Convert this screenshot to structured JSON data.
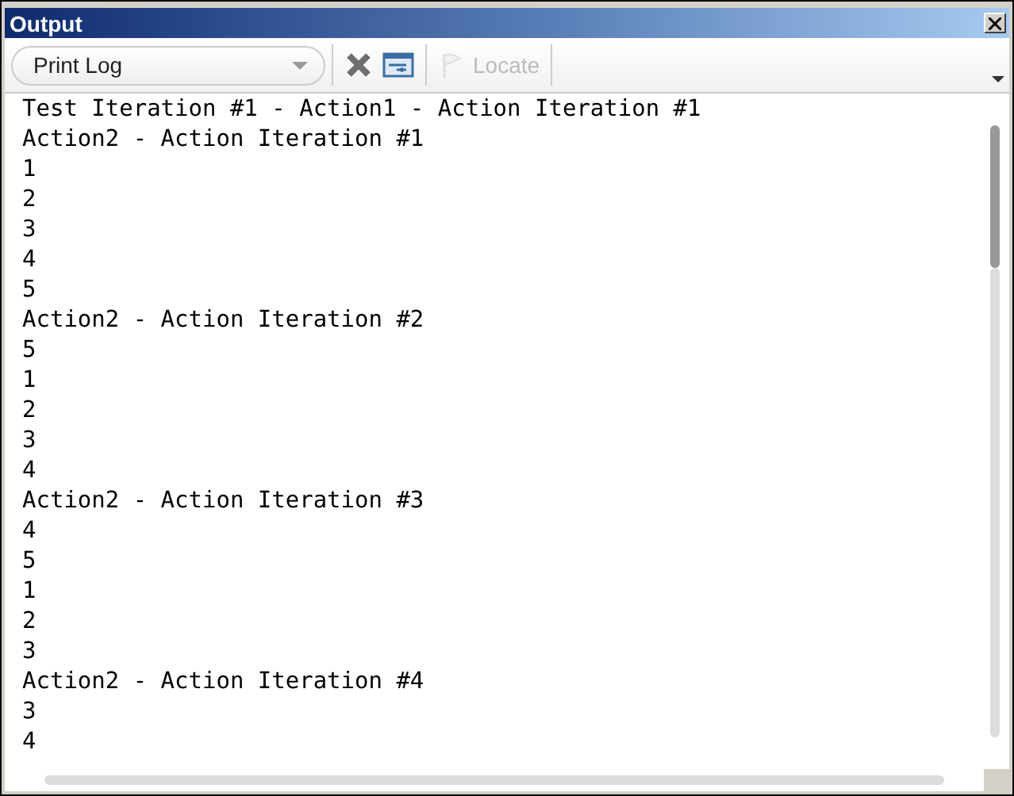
{
  "window": {
    "title": "Output"
  },
  "toolbar": {
    "log_select": {
      "value": "Print Log"
    },
    "buttons": [
      {
        "kind": "clear",
        "disabled": false
      },
      {
        "kind": "wrap",
        "disabled": false
      },
      {
        "kind": "locate",
        "label": "Locate",
        "disabled": true
      }
    ]
  },
  "log": {
    "lines": [
      "Test Iteration #1 - Action1 - Action Iteration #1",
      "Action2 - Action Iteration #1",
      "1",
      "2",
      "3",
      "4",
      "5",
      "Action2 - Action Iteration #2",
      "5",
      "1",
      "2",
      "3",
      "4",
      "Action2 - Action Iteration #3",
      "4",
      "5",
      "1",
      "2",
      "3",
      "Action2 - Action Iteration #4",
      "3",
      "4"
    ]
  }
}
